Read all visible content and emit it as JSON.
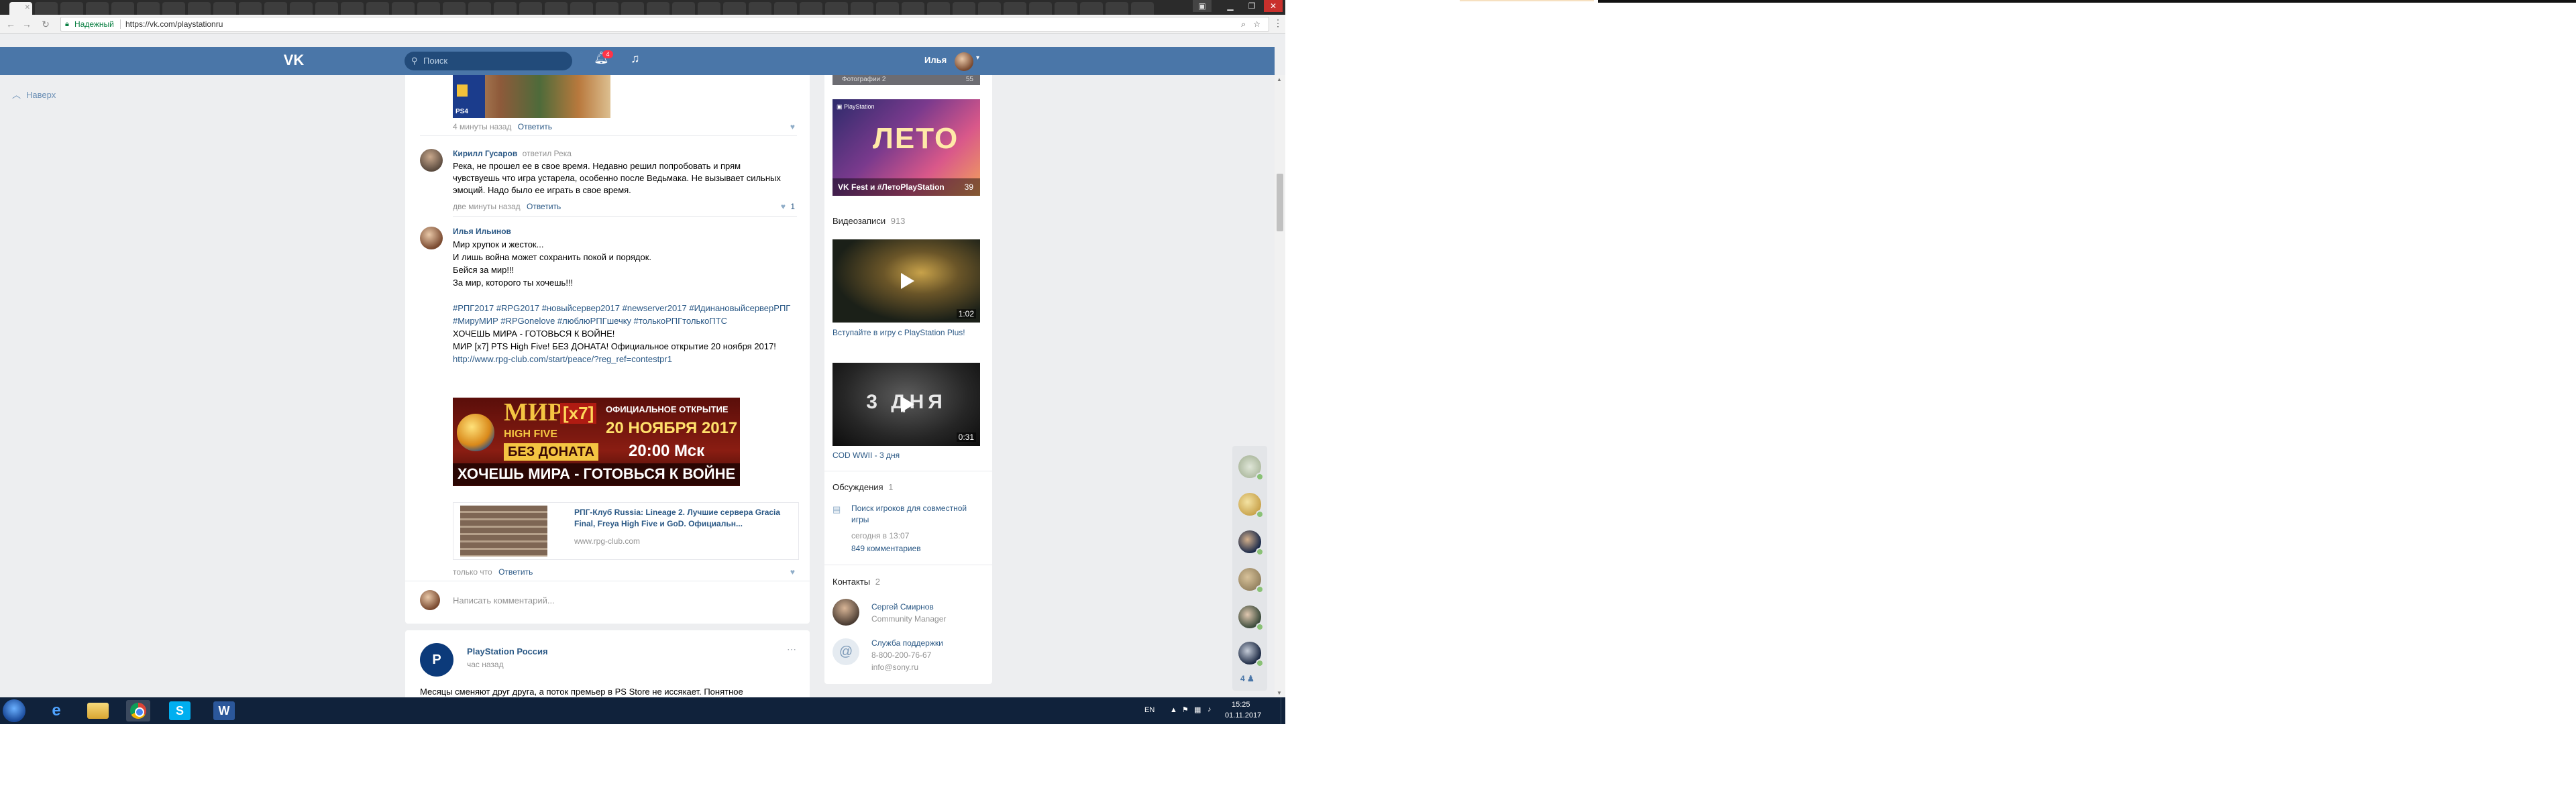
{
  "browser": {
    "secure_label": "Надежный",
    "url": "https://vk.com/playstationru"
  },
  "header": {
    "search_placeholder": "Поиск",
    "notifications_count": "4",
    "user_name": "Илья"
  },
  "sidebar": {
    "to_top": "Наверх"
  },
  "wall": {
    "reply_label": "Ответить",
    "prev_time": "4 минуты назад",
    "prev_image_caption": "PS4",
    "comment1": {
      "author": "Кирилл Гусаров",
      "replied": "ответил Река",
      "text": "Река, не прошел ее в свое время. Недавно решил попробовать и прям чувствуешь что игра устарела, особенно после Ведьмака. Не вызывает сильных эмоций. Надо было ее играть в свое время.",
      "time": "две минуты назад",
      "likes": "1"
    },
    "comment2": {
      "author": "Илья Ильинов",
      "lines": [
        "Мир хрупок и жесток...",
        "И лишь война может сохранить покой и порядок.",
        "Бейся за мир!!!",
        "За мир, которого ты хочешь!!!"
      ],
      "hashtags": "#РПГ2017 #RPG2017 #новыйсервер2017 #newserver2017 #ИдинановыйсерверРПГ #МируМИР #RPGonelove #люблюРПГшечку #толькоРПГтолькоПТС",
      "cta1": "ХОЧЕШЬ МИРА - ГОТОВЬСЯ К ВОЙНЕ!",
      "cta2": "МИР [x7] PTS High Five! БЕЗ ДОНАТА! Официальное открытие 20 ноября 2017!",
      "link": "http://www.rpg-club.com/start/peace/?reg_ref=contestpr1",
      "banner": {
        "title": "МИР",
        "rate": "[x7]",
        "hf": "HIGH FIVE",
        "official": "ОФИЦИАЛЬНОЕ ОТКРЫТИЕ",
        "date": "20 НОЯБРЯ 2017",
        "nodonate": "БЕЗ ДОНАТА",
        "time": "20:00 Мск",
        "slogan": "ХОЧЕШЬ МИРА - ГОТОВЬСЯ К ВОЙНЕ"
      },
      "snippet_title": "РПГ-Клуб Russia: Lineage 2. Лучшие сервера Gracia Final, Freya High Five и GoD. Официальн...",
      "snippet_domain": "www.rpg-club.com",
      "time": "только что"
    },
    "comment_placeholder": "Написать комментарий...",
    "post": {
      "author": "PlayStation Россия",
      "time": "час назад",
      "text": "Месяцы сменяют друг друга, а поток премьер в PS Store не иссякает. Понятное"
    }
  },
  "right": {
    "album_top_caption": "Фотографии 2",
    "album_top_count": "55",
    "album": {
      "tag": "PlayStation",
      "big": "ЛЕТО",
      "title": "VK Fest и #ЛетоPlayStation",
      "count": "39"
    },
    "videos": {
      "heading": "Видеозаписи",
      "count": "913",
      "v1_duration": "1:02",
      "v1_title": "Вступайте в игру с PlayStation Plus!",
      "v2_overlay": "3 ДНЯ",
      "v2_duration": "0:31",
      "v2_title": "COD WWII - 3 дня"
    },
    "discussions": {
      "heading": "Обсуждения",
      "count": "1",
      "topic": "Поиск игроков для совместной игры",
      "updated": "сегодня в 13:07",
      "comments": "849 комментариев"
    },
    "contacts": {
      "heading": "Контакты",
      "count": "2",
      "c1_name": "Сергей Смирнов",
      "c1_role": "Community Manager",
      "c2_name": "Служба поддержки",
      "c2_phone": "8-800-200-76-67",
      "c2_mail": "info@sony.ru"
    }
  },
  "online": {
    "more_count": "4"
  },
  "taskbar": {
    "lang": "EN",
    "time": "15:25",
    "date": "01.11.2017"
  },
  "colors": {
    "vk_blue": "#4a76a8",
    "link": "#2a5885",
    "taskbar": "#10223b"
  }
}
